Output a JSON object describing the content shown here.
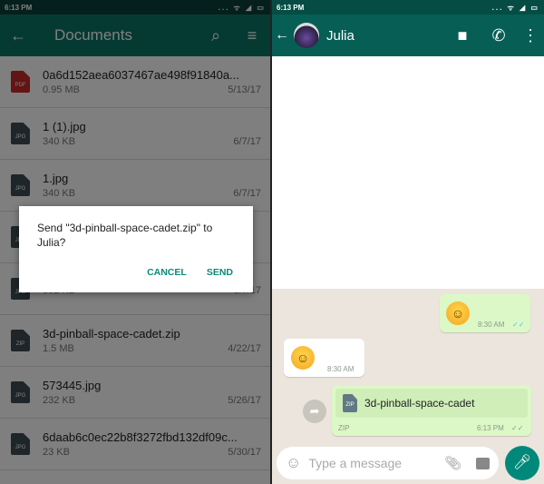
{
  "left": {
    "status": {
      "time": "6:13 PM",
      "icons": "... ᯤ ◢ ▭"
    },
    "toolbar": {
      "title": "Documents",
      "back_icon": "arrow-left",
      "search_icon": "search",
      "sort_icon": "sort"
    },
    "files": [
      {
        "type": "PDF",
        "color": "#c62828",
        "name": "0a6d152aea6037467ae498f91840a...",
        "size": "0.95 MB",
        "date": "5/13/17"
      },
      {
        "type": "JPG",
        "color": "#3d4c55",
        "name": "1 (1).jpg",
        "size": "340 KB",
        "date": "6/7/17"
      },
      {
        "type": "JPG",
        "color": "#3d4c55",
        "name": "1.jpg",
        "size": "340 KB",
        "date": "6/7/17"
      },
      {
        "type": "JPG",
        "color": "#3d4c55",
        "name": "",
        "size": "",
        "date": ""
      },
      {
        "type": "JPG",
        "color": "#3d4c55",
        "name": "",
        "size": "362 KB",
        "date": "6/7/17"
      },
      {
        "type": "ZIP",
        "color": "#3d4c55",
        "name": "3d-pinball-space-cadet.zip",
        "size": "1.5 MB",
        "date": "4/22/17"
      },
      {
        "type": "JPG",
        "color": "#3d4c55",
        "name": "573445.jpg",
        "size": "232 KB",
        "date": "5/26/17"
      },
      {
        "type": "JPG",
        "color": "#3d4c55",
        "name": "6daab6c0ec22b8f3272fbd132df09c...",
        "size": "23 KB",
        "date": "5/30/17"
      }
    ],
    "dialog": {
      "message": "Send \"3d-pinball-space-cadet.zip\" to Julia?",
      "cancel": "CANCEL",
      "send": "SEND",
      "accent": "#0a8a78"
    }
  },
  "right": {
    "status": {
      "time": "6:13 PM",
      "icons": "... ᯤ ◢ ▭"
    },
    "header": {
      "name": "Julia",
      "video_icon": "videocam",
      "call_icon": "phone",
      "menu_icon": "more-vert"
    },
    "messages": [
      {
        "dir": "out",
        "emoji": "☺",
        "time": "8:30 AM",
        "ticks": "✓✓"
      },
      {
        "dir": "in",
        "emoji": "☺",
        "time": "8:30 AM"
      },
      {
        "dir": "out",
        "file_type": "ZIP",
        "file_name": "3d-pinball-space-cadet",
        "ext": "ZIP",
        "time": "6:13 PM",
        "ticks": "✓✓"
      }
    ],
    "input": {
      "placeholder": "Type a message",
      "emoji_icon": "☺",
      "attach_icon": "paperclip",
      "camera_icon": "camera",
      "mic_icon": "mic"
    },
    "forward_icon": "➦"
  }
}
